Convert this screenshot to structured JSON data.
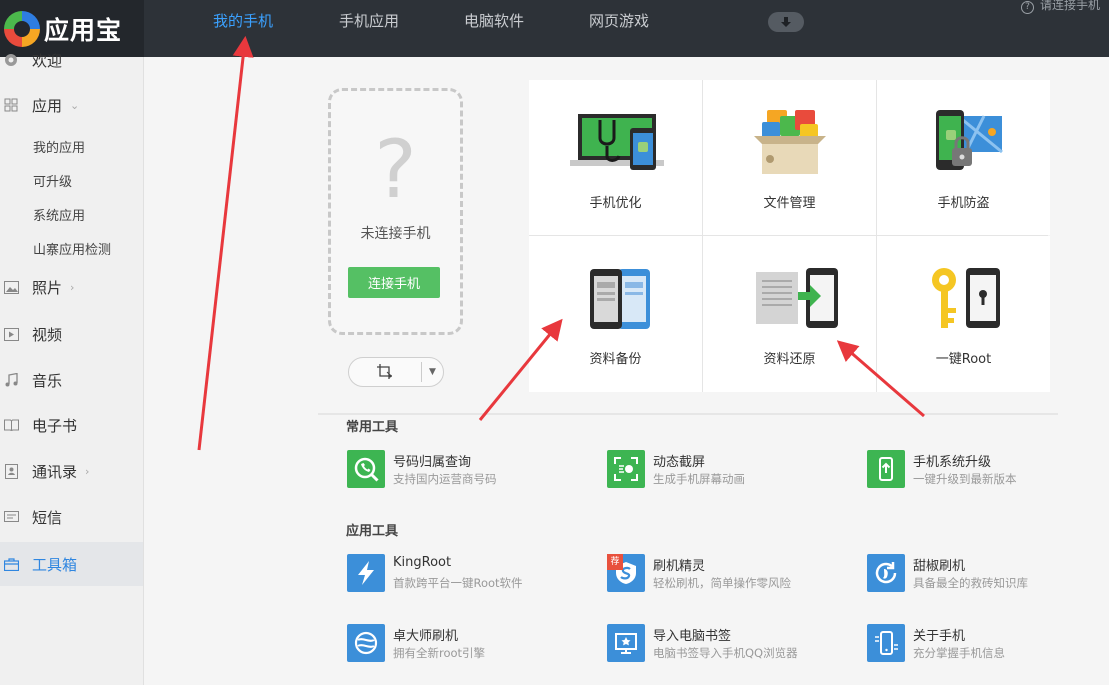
{
  "header": {
    "app_name": "应用宝",
    "nav": [
      "我的手机",
      "手机应用",
      "电脑软件",
      "网页游戏"
    ],
    "help_text": "请连接手机"
  },
  "sidebar": {
    "items": [
      {
        "label": "欢迎",
        "icon": "welcome-icon"
      },
      {
        "label": "应用",
        "icon": "grid-icon"
      },
      {
        "label": "照片",
        "icon": "image-icon"
      },
      {
        "label": "视频",
        "icon": "video-icon"
      },
      {
        "label": "音乐",
        "icon": "music-icon"
      },
      {
        "label": "电子书",
        "icon": "book-icon"
      },
      {
        "label": "通讯录",
        "icon": "contacts-icon"
      },
      {
        "label": "短信",
        "icon": "message-icon"
      },
      {
        "label": "工具箱",
        "icon": "toolbox-icon"
      }
    ],
    "subitems": [
      "我的应用",
      "可升级",
      "系统应用",
      "山寨应用检测"
    ]
  },
  "phone": {
    "status": "未连接手机",
    "connect_label": "连接手机"
  },
  "features": [
    {
      "label": "手机优化"
    },
    {
      "label": "文件管理"
    },
    {
      "label": "手机防盗"
    },
    {
      "label": "资料备份"
    },
    {
      "label": "资料还原"
    },
    {
      "label": "一键Root"
    }
  ],
  "sections": {
    "common": "常用工具",
    "apps": "应用工具"
  },
  "common_tools": [
    {
      "name": "号码归属查询",
      "desc": "支持国内运营商号码"
    },
    {
      "name": "动态截屏",
      "desc": "生成手机屏幕动画"
    },
    {
      "name": "手机系统升级",
      "desc": "一键升级到最新版本"
    }
  ],
  "app_tools": [
    {
      "name": "KingRoot",
      "desc": "首款跨平台一键Root软件"
    },
    {
      "name": "刷机精灵",
      "desc": "轻松刷机，简单操作零风险",
      "badge": "荐"
    },
    {
      "name": "甜椒刷机",
      "desc": "具备最全的救砖知识库"
    },
    {
      "name": "卓大师刷机",
      "desc": "拥有全新root引擎"
    },
    {
      "name": "导入电脑书签",
      "desc": "电脑书签导入手机QQ浏览器"
    },
    {
      "name": "关于手机",
      "desc": "充分掌握手机信息"
    }
  ],
  "colors": {
    "header_bg": "#2d3238",
    "accent_blue": "#3ba1ff",
    "green": "#55c064",
    "annotation_red": "#e8383d"
  }
}
